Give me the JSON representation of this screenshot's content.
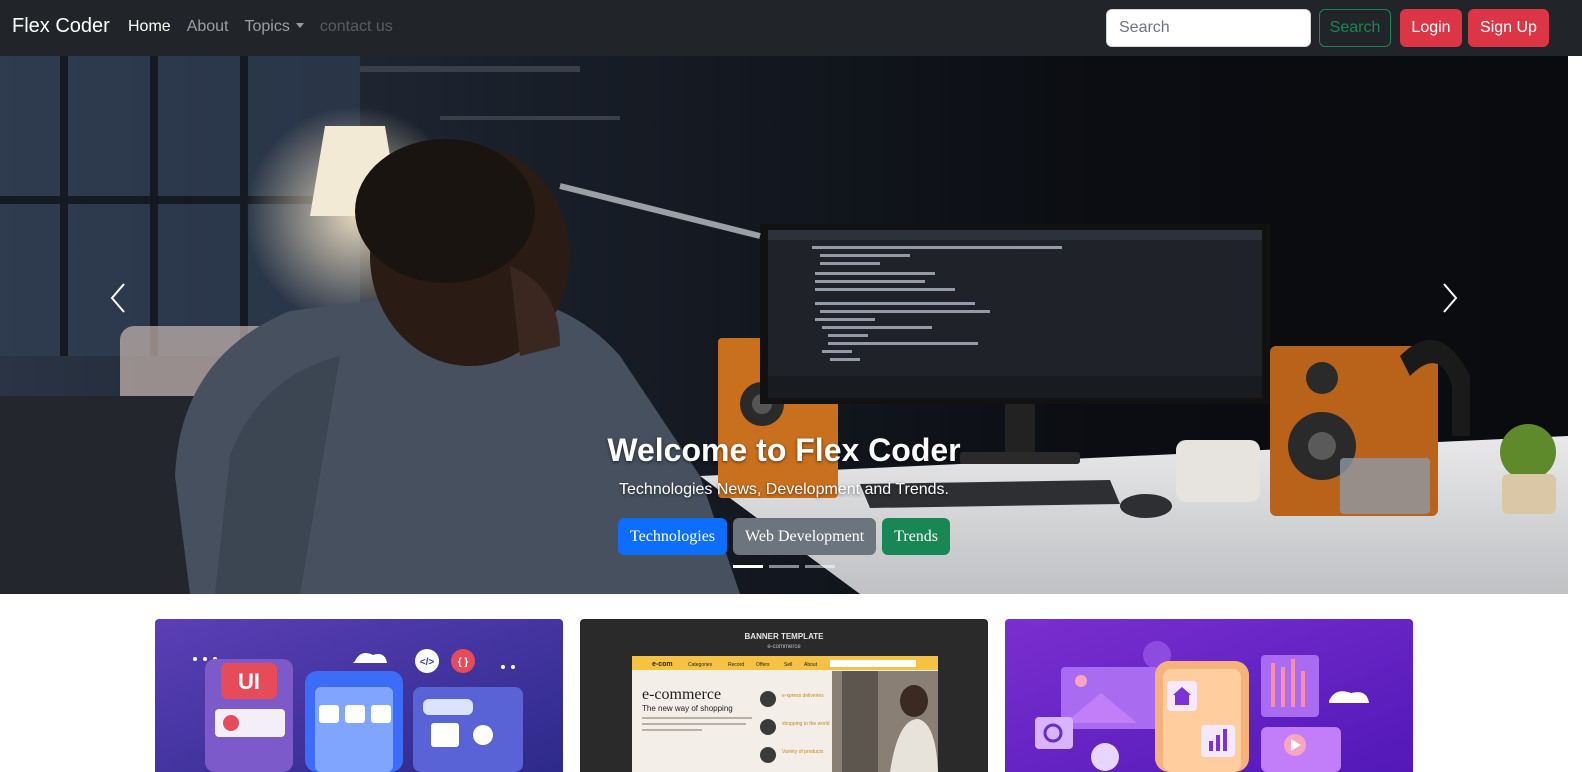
{
  "navbar": {
    "brand": "Flex Coder",
    "links": [
      {
        "label": "Home",
        "state": "active"
      },
      {
        "label": "About",
        "state": "normal"
      },
      {
        "label": "Topics",
        "state": "dropdown"
      },
      {
        "label": "contact us",
        "state": "disabled"
      }
    ],
    "search_placeholder": "Search",
    "search_button": "Search",
    "login_button": "Login",
    "signup_button": "Sign Up"
  },
  "carousel": {
    "title": "Welcome to Flex Coder",
    "subtitle": "Technologies News, Development and Trends.",
    "buttons": [
      "Technologies",
      "Web Development",
      "Trends"
    ],
    "slide_count": 3,
    "active_slide": 0,
    "prev_icon": "chevron-left-icon",
    "next_icon": "chevron-right-icon"
  },
  "cards": [
    {
      "image": "ui-design-illustration",
      "icon_labels": [
        "UI",
        "</>",
        "{ }"
      ]
    },
    {
      "image": "ecommerce-banner-template",
      "header": "BANNER TEMPLATE",
      "subheader": "e-commerce",
      "logo": "e-com",
      "menu": [
        "Categories",
        "Record",
        "Offers",
        "Sell",
        "About"
      ],
      "headline": "e-commerce",
      "tagline": "The new way of shopping",
      "lorem": "Lorem ipsum dolor sit amet, consecte-tur adipiscing elit, sed do eiusmod tempor incididunt",
      "features": [
        "e-xpress deliveries",
        "shopping to the world",
        "Variety of products"
      ]
    },
    {
      "image": "mobile-app-dev-illustration"
    }
  ],
  "colors": {
    "navbar_bg": "#212529",
    "danger": "#dc3545",
    "success": "#198754",
    "primary": "#0d6efd",
    "secondary": "#6c757d"
  }
}
